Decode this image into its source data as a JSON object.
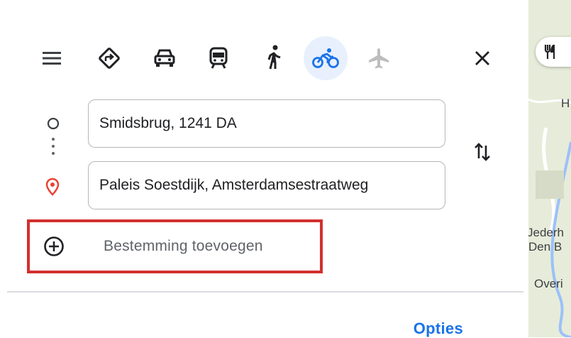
{
  "travel_modes": [
    {
      "name": "best",
      "icon": "directions-diamond-icon"
    },
    {
      "name": "car",
      "icon": "car-icon"
    },
    {
      "name": "transit",
      "icon": "train-icon"
    },
    {
      "name": "walking",
      "icon": "walking-icon"
    },
    {
      "name": "bicycle",
      "icon": "bicycle-icon",
      "selected": true
    },
    {
      "name": "flight",
      "icon": "airplane-icon",
      "disabled": true
    }
  ],
  "route": {
    "origin": "Smidsbrug, 1241 DA",
    "destination": "Paleis Soestdijk, Amsterdamsestraatweg"
  },
  "add_destination_label": "Bestemming toevoegen",
  "options_label": "Opties",
  "map": {
    "labels": [
      "H",
      "Jederh",
      "Den B",
      "Overi"
    ]
  },
  "colors": {
    "accent": "#1a73e8",
    "destination_pin": "#ea4335",
    "highlight_box": "#d32f2f",
    "active_mode_bg": "#e8f0fe"
  }
}
